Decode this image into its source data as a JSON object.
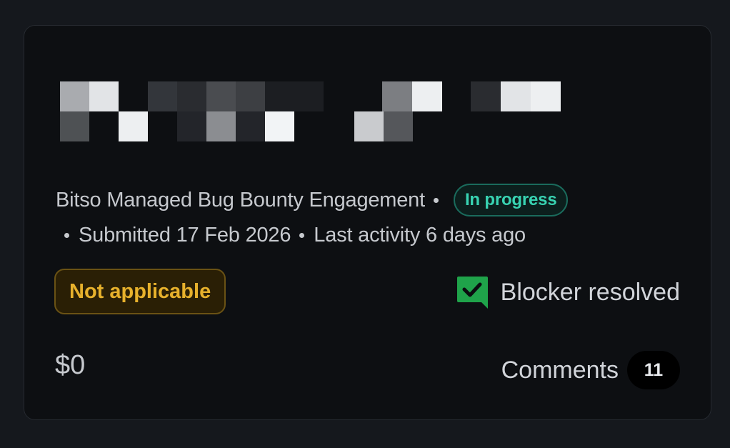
{
  "report": {
    "program": "Bitso Managed Bug Bounty Engagement",
    "status": "In progress",
    "submitted": "Submitted 17 Feb 2026",
    "last_activity": "Last activity 6 days ago",
    "state": "Not applicable",
    "blocker": "Blocker resolved",
    "bounty": "$0",
    "comments_label": "Comments",
    "comments_count": "11"
  },
  "icons": {
    "blocker": "checkmark-chat-icon"
  },
  "colors": {
    "background": "#15181d",
    "card": "#0d0f12",
    "status_accent": "#38d3b2",
    "state_accent": "#e7b12c",
    "blocker_icon": "#1fa34a"
  }
}
